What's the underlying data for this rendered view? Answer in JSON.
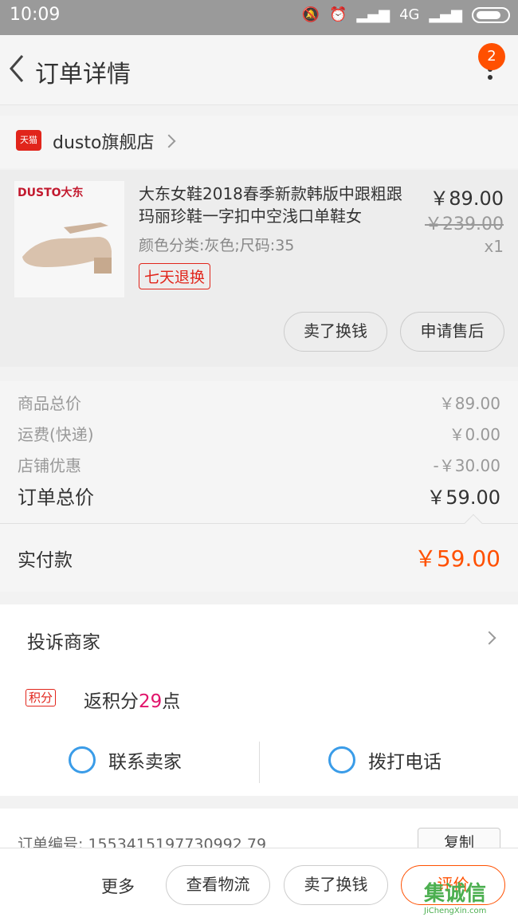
{
  "status_bar": {
    "time": "10:09",
    "network": "4G"
  },
  "nav": {
    "title": "订单详情",
    "badge_count": "2"
  },
  "shop": {
    "platform_tag": "天猫",
    "name": "dusto旗舰店"
  },
  "item": {
    "brand_mark": "DUSTO大东",
    "title": "大东女鞋2018春季新款韩版中跟粗跟玛丽珍鞋一字扣中空浅口单鞋女",
    "sku": "颜色分类:灰色;尺码:35",
    "tag": "七天退换",
    "price": "￥89.00",
    "original_price": "￥239.00",
    "quantity": "x1",
    "buttons": [
      "卖了换钱",
      "申请售后"
    ]
  },
  "summary": {
    "rows": [
      {
        "label": "商品总价",
        "value": "￥89.00"
      },
      {
        "label": "运费(快递)",
        "value": "￥0.00"
      },
      {
        "label": "店铺优惠",
        "value": "-￥30.00"
      }
    ],
    "total": {
      "label": "订单总价",
      "value": "￥59.00"
    },
    "paid": {
      "label": "实付款",
      "value": "￥59.00"
    }
  },
  "actions": {
    "complain": "投诉商家",
    "points_tag": "积分",
    "points_prefix": "返积分",
    "points_value": "29",
    "points_suffix": "点",
    "contact_seller": "联系卖家",
    "call_phone": "拨打电话"
  },
  "order_info": {
    "label": "订单编号: 1553415197730992 79",
    "copy": "复制"
  },
  "bottom_bar": {
    "more": "更多",
    "buttons": [
      "查看物流",
      "卖了换钱",
      "评价"
    ]
  },
  "watermark": {
    "logo": "集诚信",
    "url": "JiChengXin.com"
  },
  "colors": {
    "accent": "#ff5000",
    "tmall": "#e1251b",
    "blue": "#3a9ce8"
  }
}
